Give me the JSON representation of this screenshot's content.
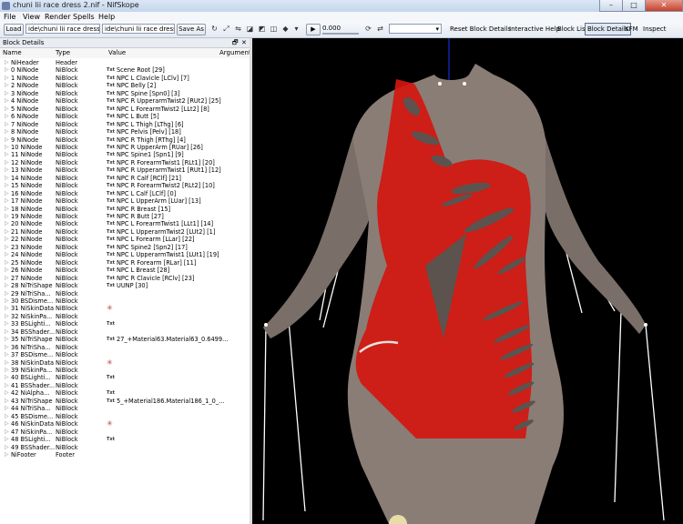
{
  "window": {
    "title": "chuni lii race dress 2.nif - NifSkope",
    "minimize": "–",
    "maximize": "□",
    "close": "✕"
  },
  "menu": [
    "File",
    "View",
    "Render",
    "Spells",
    "Help"
  ],
  "toolbar": {
    "load": "Load",
    "load_path": "ide\\chuni lii race dress 2.nif",
    "save_path": "ide\\chuni lii race dress 2.nif",
    "save_as": "Save As",
    "time_value": "0.000",
    "reset_block_details": "Reset Block Details",
    "interactive_help": "Interactive Help",
    "block_list": "Block List",
    "block_details": "Block Details",
    "kfm": "KFM",
    "inspect": "Inspect"
  },
  "panel": {
    "title": "Block Details",
    "float_icon": "🗗",
    "close_icon": "✕",
    "columns": [
      "Name",
      "Type",
      "Value",
      "Argument"
    ]
  },
  "rows": [
    {
      "name": "NiHeader",
      "type": "Header",
      "txt": "",
      "value": "",
      "icon": ""
    },
    {
      "name": "0 NiNode",
      "type": "NiBlock",
      "txt": "Txt",
      "value": "Scene Root [29]",
      "icon": ""
    },
    {
      "name": "1 NiNode",
      "type": "NiBlock",
      "txt": "Txt",
      "value": "NPC L Clavicle [LClv] [7]",
      "icon": ""
    },
    {
      "name": "2 NiNode",
      "type": "NiBlock",
      "txt": "Txt",
      "value": "NPC Belly [2]",
      "icon": ""
    },
    {
      "name": "3 NiNode",
      "type": "NiBlock",
      "txt": "Txt",
      "value": "NPC Spine [Spn0] [3]",
      "icon": ""
    },
    {
      "name": "4 NiNode",
      "type": "NiBlock",
      "txt": "Txt",
      "value": "NPC R UpperarmTwist2 [RUt2] [25]",
      "icon": ""
    },
    {
      "name": "5 NiNode",
      "type": "NiBlock",
      "txt": "Txt",
      "value": "NPC L ForearmTwist2 [LLt2] [8]",
      "icon": ""
    },
    {
      "name": "6 NiNode",
      "type": "NiBlock",
      "txt": "Txt",
      "value": "NPC L Butt [5]",
      "icon": ""
    },
    {
      "name": "7 NiNode",
      "type": "NiBlock",
      "txt": "Txt",
      "value": "NPC L Thigh [LThg] [6]",
      "icon": ""
    },
    {
      "name": "8 NiNode",
      "type": "NiBlock",
      "txt": "Txt",
      "value": "NPC Pelvis [Pelv] [18]",
      "icon": ""
    },
    {
      "name": "9 NiNode",
      "type": "NiBlock",
      "txt": "Txt",
      "value": "NPC R Thigh [RThg] [4]",
      "icon": ""
    },
    {
      "name": "10 NiNode",
      "type": "NiBlock",
      "txt": "Txt",
      "value": "NPC R UpperArm [RUar] [26]",
      "icon": ""
    },
    {
      "name": "11 NiNode",
      "type": "NiBlock",
      "txt": "Txt",
      "value": "NPC Spine1 [Spn1] [9]",
      "icon": ""
    },
    {
      "name": "12 NiNode",
      "type": "NiBlock",
      "txt": "Txt",
      "value": "NPC R ForearmTwist1 [RLt1] [20]",
      "icon": ""
    },
    {
      "name": "13 NiNode",
      "type": "NiBlock",
      "txt": "Txt",
      "value": "NPC R UpperarmTwist1 [RUt1] [12]",
      "icon": ""
    },
    {
      "name": "14 NiNode",
      "type": "NiBlock",
      "txt": "Txt",
      "value": "NPC R Calf [RClf] [21]",
      "icon": ""
    },
    {
      "name": "15 NiNode",
      "type": "NiBlock",
      "txt": "Txt",
      "value": "NPC R ForearmTwist2 [RLt2] [10]",
      "icon": ""
    },
    {
      "name": "16 NiNode",
      "type": "NiBlock",
      "txt": "Txt",
      "value": "NPC L Calf [LClf] [0]",
      "icon": ""
    },
    {
      "name": "17 NiNode",
      "type": "NiBlock",
      "txt": "Txt",
      "value": "NPC L UpperArm [LUar] [13]",
      "icon": ""
    },
    {
      "name": "18 NiNode",
      "type": "NiBlock",
      "txt": "Txt",
      "value": "NPC R Breast [15]",
      "icon": ""
    },
    {
      "name": "19 NiNode",
      "type": "NiBlock",
      "txt": "Txt",
      "value": "NPC R Butt [27]",
      "icon": ""
    },
    {
      "name": "20 NiNode",
      "type": "NiBlock",
      "txt": "Txt",
      "value": "NPC L ForearmTwist1 [LLt1] [14]",
      "icon": ""
    },
    {
      "name": "21 NiNode",
      "type": "NiBlock",
      "txt": "Txt",
      "value": "NPC L UpperarmTwist2 [LUt2] [1]",
      "icon": ""
    },
    {
      "name": "22 NiNode",
      "type": "NiBlock",
      "txt": "Txt",
      "value": "NPC L Forearm [LLar] [22]",
      "icon": ""
    },
    {
      "name": "23 NiNode",
      "type": "NiBlock",
      "txt": "Txt",
      "value": "NPC Spine2 [Spn2] [17]",
      "icon": ""
    },
    {
      "name": "24 NiNode",
      "type": "NiBlock",
      "txt": "Txt",
      "value": "NPC L UpperarmTwist1 [LUt1] [19]",
      "icon": ""
    },
    {
      "name": "25 NiNode",
      "type": "NiBlock",
      "txt": "Txt",
      "value": "NPC R Forearm [RLar] [11]",
      "icon": ""
    },
    {
      "name": "26 NiNode",
      "type": "NiBlock",
      "txt": "Txt",
      "value": "NPC L Breast [28]",
      "icon": ""
    },
    {
      "name": "27 NiNode",
      "type": "NiBlock",
      "txt": "Txt",
      "value": "NPC R Clavicle [RClv] [23]",
      "icon": ""
    },
    {
      "name": "28 NiTriShape",
      "type": "NiBlock",
      "txt": "Txt",
      "value": "UUNP [30]",
      "icon": ""
    },
    {
      "name": "29 NiTriSha...",
      "type": "NiBlock",
      "txt": "",
      "value": "",
      "icon": ""
    },
    {
      "name": "30 BSDisme...",
      "type": "NiBlock",
      "txt": "",
      "value": "",
      "icon": ""
    },
    {
      "name": "31 NiSkinData",
      "type": "NiBlock",
      "txt": "",
      "value": "",
      "icon": "✳"
    },
    {
      "name": "32 NiSkinPa...",
      "type": "NiBlock",
      "txt": "",
      "value": "",
      "icon": ""
    },
    {
      "name": "33 BSLighti...",
      "type": "NiBlock",
      "txt": "Txt",
      "value": "",
      "icon": ""
    },
    {
      "name": "34 BSShader...",
      "type": "NiBlock",
      "txt": "",
      "value": "",
      "icon": ""
    },
    {
      "name": "35 NiTriShape",
      "type": "NiBlock",
      "txt": "Txt",
      "value": "27_+Material63.Material63_0.6499...",
      "icon": ""
    },
    {
      "name": "36 NiTriSha...",
      "type": "NiBlock",
      "txt": "",
      "value": "",
      "icon": ""
    },
    {
      "name": "37 BSDisme...",
      "type": "NiBlock",
      "txt": "",
      "value": "",
      "icon": ""
    },
    {
      "name": "38 NiSkinData",
      "type": "NiBlock",
      "txt": "",
      "value": "",
      "icon": "✳"
    },
    {
      "name": "39 NiSkinPa...",
      "type": "NiBlock",
      "txt": "",
      "value": "",
      "icon": ""
    },
    {
      "name": "40 BSLighti...",
      "type": "NiBlock",
      "txt": "Txt",
      "value": "",
      "icon": ""
    },
    {
      "name": "41 BSShader...",
      "type": "NiBlock",
      "txt": "",
      "value": "",
      "icon": ""
    },
    {
      "name": "42 NiAlpha...",
      "type": "NiBlock",
      "txt": "Txt",
      "value": "",
      "icon": ""
    },
    {
      "name": "43 NiTriShape",
      "type": "NiBlock",
      "txt": "Txt",
      "value": "5_+Material186.Material186_1_0_...",
      "icon": ""
    },
    {
      "name": "44 NiTriSha...",
      "type": "NiBlock",
      "txt": "",
      "value": "",
      "icon": ""
    },
    {
      "name": "45 BSDisme...",
      "type": "NiBlock",
      "txt": "",
      "value": "",
      "icon": ""
    },
    {
      "name": "46 NiSkinData",
      "type": "NiBlock",
      "txt": "",
      "value": "",
      "icon": "✳"
    },
    {
      "name": "47 NiSkinPa...",
      "type": "NiBlock",
      "txt": "",
      "value": "",
      "icon": ""
    },
    {
      "name": "48 BSLighti...",
      "type": "NiBlock",
      "txt": "Txt",
      "value": "",
      "icon": ""
    },
    {
      "name": "49 BSShader...",
      "type": "NiBlock",
      "txt": "",
      "value": "",
      "icon": ""
    },
    {
      "name": "NiFooter",
      "type": "Footer",
      "txt": "",
      "value": "",
      "icon": ""
    }
  ],
  "colors": {
    "viewport_bg": "#000000",
    "skin": "#8a7d76",
    "dress": "#d2160f",
    "axis": "#1030d0"
  }
}
